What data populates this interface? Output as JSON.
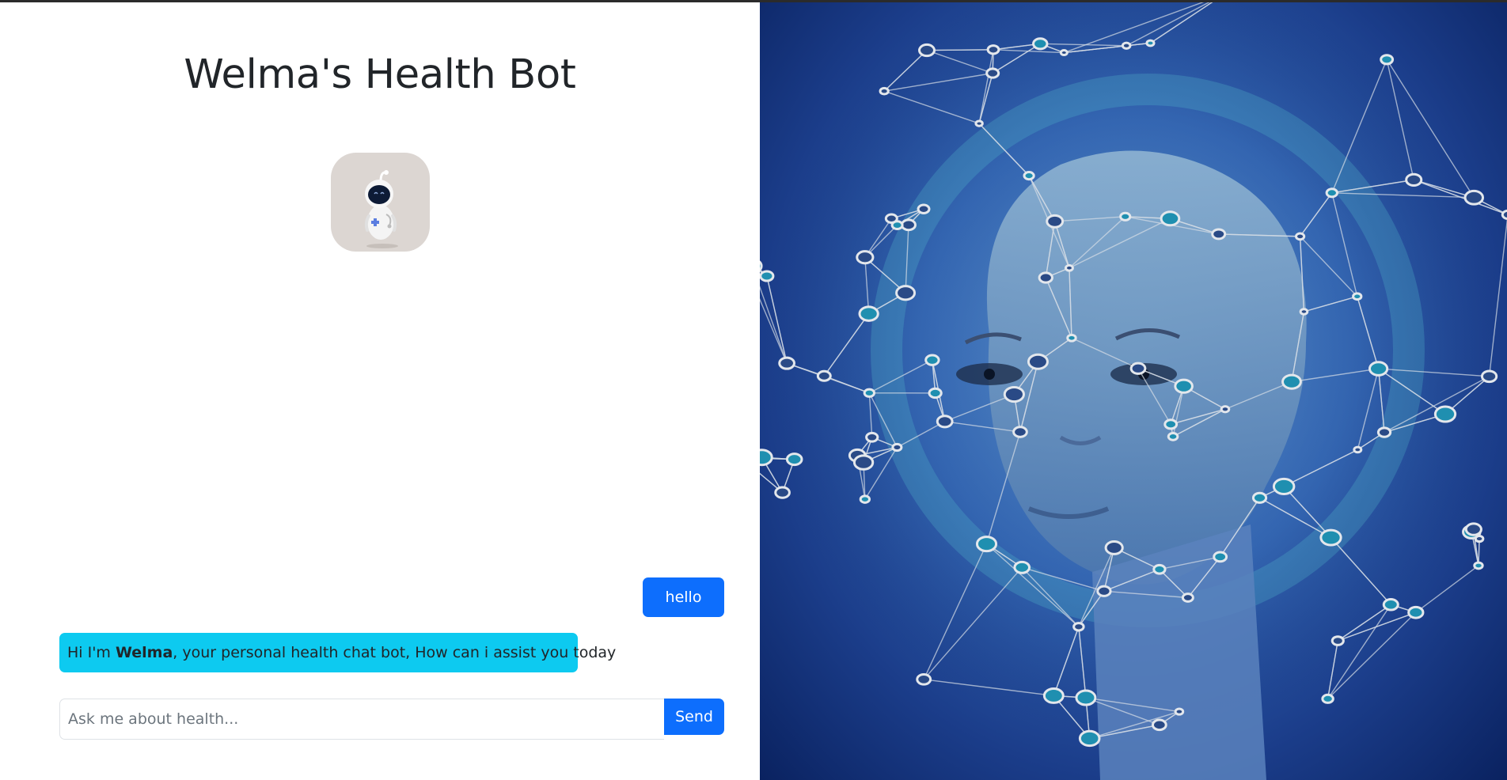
{
  "header": {
    "title": "Welma's Health Bot"
  },
  "avatar": {
    "icon": "robot-nurse-icon"
  },
  "chat": {
    "messages": [
      {
        "role": "user",
        "text": "hello"
      },
      {
        "role": "bot",
        "prefix": "Hi I'm ",
        "name": "Welma",
        "suffix": ", your personal health chat bot, How can i assist you today"
      }
    ],
    "input_placeholder": "Ask me about health...",
    "input_value": "",
    "send_label": "Send"
  },
  "hero": {
    "image": "ai-face-network-illustration"
  },
  "colors": {
    "primary": "#0d6efd",
    "info": "#0dcaf0",
    "text": "#212529",
    "avatar_bg": "#dcd6d2",
    "hero_blue": "#2f5fae"
  }
}
